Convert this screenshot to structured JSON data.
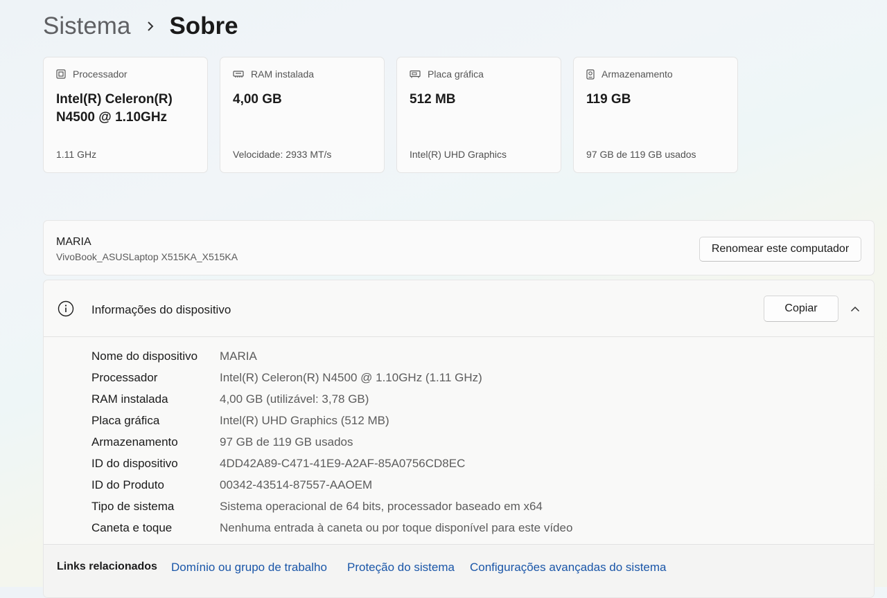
{
  "breadcrumb": {
    "parent": "Sistema",
    "current": "Sobre"
  },
  "cards": [
    {
      "icon": "processor-icon",
      "label": "Processador",
      "value": "Intel(R) Celeron(R) N4500 @ 1.10GHz",
      "sub": "1.11 GHz"
    },
    {
      "icon": "ram-icon",
      "label": "RAM instalada",
      "value": "4,00 GB",
      "sub": "Velocidade: 2933 MT/s"
    },
    {
      "icon": "graphics-card-icon",
      "label": "Placa gráfica",
      "value": "512 MB",
      "sub": "Intel(R) UHD Graphics"
    },
    {
      "icon": "storage-icon",
      "label": "Armazenamento",
      "value": "119 GB",
      "sub": "97 GB de 119 GB usados"
    }
  ],
  "computer": {
    "name": "MARIA",
    "model": "VivoBook_ASUSLaptop X515KA_X515KA",
    "rename_label": "Renomear este computador"
  },
  "device_info": {
    "title": "Informações do dispositivo",
    "copy_label": "Copiar",
    "rows": [
      {
        "label": "Nome do dispositivo",
        "value": "MARIA"
      },
      {
        "label": "Processador",
        "value": "Intel(R) Celeron(R) N4500 @ 1.10GHz (1.11 GHz)"
      },
      {
        "label": "RAM instalada",
        "value": "4,00 GB (utilizável: 3,78 GB)"
      },
      {
        "label": "Placa gráfica",
        "value": "Intel(R) UHD Graphics (512 MB)"
      },
      {
        "label": "Armazenamento",
        "value": "97 GB de 119 GB usados"
      },
      {
        "label": "ID do dispositivo",
        "value": "4DD42A89-C471-41E9-A2AF-85A0756CD8EC"
      },
      {
        "label": "ID do Produto",
        "value": "00342-43514-87557-AAOEM"
      },
      {
        "label": "Tipo de sistema",
        "value": "Sistema operacional de 64 bits, processador baseado em x64"
      },
      {
        "label": "Caneta e toque",
        "value": "Nenhuma entrada à caneta ou por toque disponível para este vídeo"
      }
    ]
  },
  "related_links": {
    "title": "Links relacionados",
    "links": [
      "Domínio ou grupo de trabalho",
      "Proteção do sistema",
      "Configurações avançadas do sistema"
    ]
  },
  "colors": {
    "link": "#1a56a8",
    "accent_text": "#1b1b1b"
  }
}
